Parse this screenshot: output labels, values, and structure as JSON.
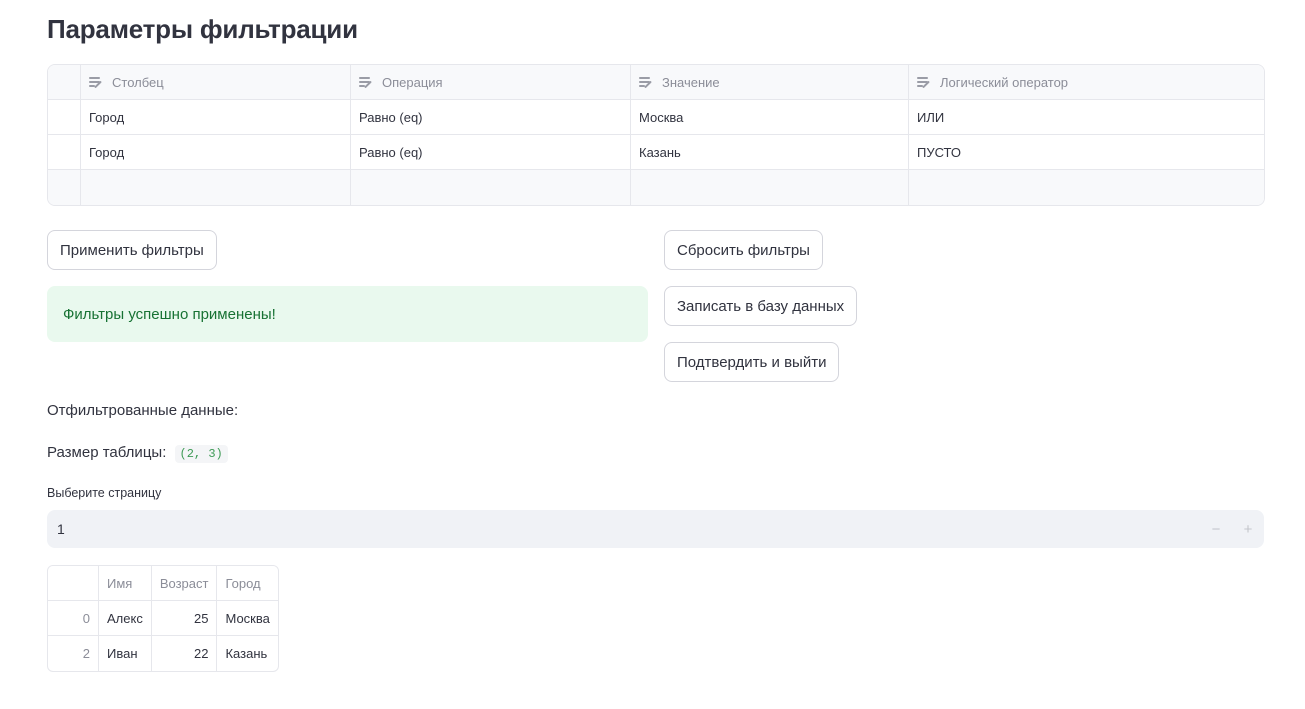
{
  "page": {
    "title": "Параметры фильтрации"
  },
  "filter_editor": {
    "columns": [
      "Столбец",
      "Операция",
      "Значение",
      "Логический оператор"
    ],
    "rows": [
      [
        "Город",
        "Равно (eq)",
        "Москва",
        "ИЛИ"
      ],
      [
        "Город",
        "Равно (eq)",
        "Казань",
        "ПУСТО"
      ]
    ]
  },
  "buttons": {
    "apply": "Применить фильтры",
    "reset": "Сбросить фильтры",
    "save_db": "Записать в базу данных",
    "confirm_exit": "Подтвердить и выйти"
  },
  "alert": {
    "success": "Фильтры успешно применены!"
  },
  "filtered": {
    "heading": "Отфильтрованные данные:",
    "size_label": "Размер таблицы:",
    "size_value": "(2, 3)"
  },
  "pagination": {
    "label": "Выберите страницу",
    "value": "1",
    "minus": "−",
    "plus": "+"
  },
  "data_table": {
    "columns": [
      "Имя",
      "Возраст",
      "Город"
    ],
    "rows": [
      {
        "index": "0",
        "cells": [
          "Алекс",
          "25",
          "Москва"
        ]
      },
      {
        "index": "2",
        "cells": [
          "Иван",
          "22",
          "Казань"
        ]
      }
    ]
  }
}
